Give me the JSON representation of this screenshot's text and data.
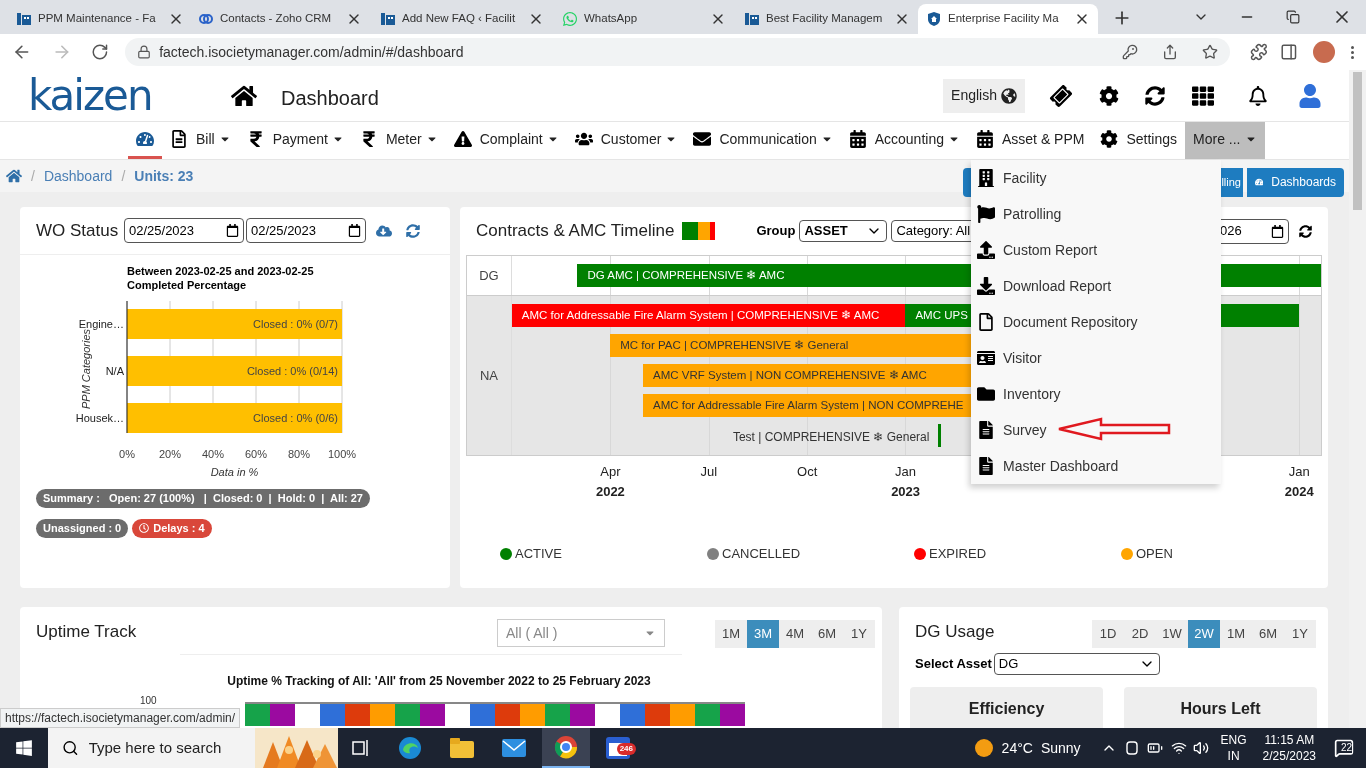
{
  "browser": {
    "tabs": [
      {
        "title": "PPM Maintenance - Fa",
        "selected": false
      },
      {
        "title": "Contacts - Zoho CRM",
        "selected": false
      },
      {
        "title": "Add New FAQ ‹ Facilit",
        "selected": false
      },
      {
        "title": "WhatsApp",
        "selected": false
      },
      {
        "title": "Best Facility Managem",
        "selected": false
      },
      {
        "title": "Enterprise Facility Ma",
        "selected": true
      }
    ],
    "url": "factech.isocietymanager.com/admin/#/dashboard",
    "status_url": "https://factech.isocietymanager.com/admin/"
  },
  "header": {
    "logo": "kaizen",
    "title": "Dashboard",
    "language": "English"
  },
  "nav": [
    {
      "selected": true,
      "dropdown": false
    },
    {
      "label": "Bill",
      "dropdown": true,
      "selected": false
    },
    {
      "label": "Payment",
      "dropdown": true,
      "selected": false
    },
    {
      "label": "Meter",
      "dropdown": true,
      "selected": false
    },
    {
      "label": "Complaint",
      "dropdown": true,
      "selected": false
    },
    {
      "label": "Customer",
      "dropdown": true,
      "selected": false
    },
    {
      "label": "Communication",
      "dropdown": true,
      "selected": false
    },
    {
      "label": "Accounting",
      "dropdown": true,
      "selected": false
    },
    {
      "label": "Asset & PPM",
      "dropdown": false,
      "selected": false
    },
    {
      "label": "Settings",
      "dropdown": false,
      "selected": false
    },
    {
      "label": "More ...",
      "dropdown": true,
      "selected": false,
      "open": true
    }
  ],
  "breadcrumb": {
    "separators": [
      "/",
      "/"
    ],
    "items": [
      "Dashboard"
    ],
    "units": "Units: 23",
    "buttons": [
      "lling",
      "Dashboards"
    ]
  },
  "more_menu": {
    "items": [
      {
        "label": "Facility",
        "annotated": false
      },
      {
        "label": "Patrolling",
        "annotated": false
      },
      {
        "label": "Custom Report",
        "annotated": false
      },
      {
        "label": "Download Report",
        "annotated": false
      },
      {
        "label": "Document Repository",
        "annotated": false
      },
      {
        "label": "Visitor",
        "annotated": false
      },
      {
        "label": "Inventory",
        "annotated": false
      },
      {
        "label": "Survey",
        "annotated": true
      },
      {
        "label": "Master Dashboard",
        "annotated": false
      }
    ]
  },
  "wo_status": {
    "title": "WO Status",
    "dates": [
      "02/25/2023",
      "02/25/2023"
    ],
    "chart_data": {
      "type": "bar",
      "orientation": "horizontal",
      "grid": true,
      "title": "Between 2023-02-25 and 2023-02-25\nCompleted Percentage",
      "xlabel": "Data in %",
      "ylabel": "PPM Categories",
      "categories": [
        "Engine…",
        "N/A",
        "Housek…"
      ],
      "series": [
        {
          "color": "#ffbf00",
          "values": [
            100,
            100,
            100
          ]
        }
      ],
      "xlim": [
        0,
        100
      ],
      "xticks": [
        {
          "value": 0,
          "label": "0%"
        },
        {
          "value": 20,
          "label": "20%"
        },
        {
          "value": 40,
          "label": "40%"
        },
        {
          "value": 60,
          "label": "60%"
        },
        {
          "value": 80,
          "label": "80%"
        },
        {
          "value": 100,
          "label": "100%"
        }
      ],
      "value_labels": [
        "Closed : 0% (0/7)",
        "Closed : 0% (0/14)",
        "Closed : 0% (0/6)"
      ]
    },
    "summary": "Summary :   Open: 27 (100%)   |  Closed: 0  |  Hold: 0  |  All: 27",
    "badges": [
      {
        "label": "Unassigned : 0",
        "kind": "neutral"
      },
      {
        "label": "Delays : 4",
        "kind": "alert"
      }
    ]
  },
  "contracts": {
    "title": "Contracts & AMC Timeline",
    "group_label": "Group",
    "group": "ASSET",
    "category": "Category: All",
    "date_fragment": "026",
    "groups": [
      {
        "label": "DG",
        "lanes": [
          [
            {
              "label": "DG AMC | COMPREHENSIVE ❄ AMC",
              "color": "#008000",
              "kind": "bar"
            }
          ]
        ]
      },
      {
        "label": "NA",
        "lanes": [
          [
            {
              "label": "AMC for Addressable Fire Alarm System | COMPREHENSIVE ❄ AMC",
              "color": "#ff0000",
              "kind": "bar"
            },
            {
              "label": "AMC UPS",
              "color": "#008000",
              "kind": "bar"
            }
          ],
          [
            {
              "label": "MC for PAC | COMPREHENSIVE ❄ General",
              "color": "#ffa500",
              "kind": "bar"
            }
          ],
          [
            {
              "label": "AMC VRF System | NON COMPREHENSIVE ❄ AMC",
              "color": "#ffa500",
              "kind": "bar"
            }
          ],
          [
            {
              "label": "AMC for Addressable Fire Alarm System | NON COMPREHE",
              "color": "#ffa500",
              "kind": "bar"
            }
          ],
          [
            {
              "label": "Test | COMPREHENSIVE ❄ General",
              "color": "#008000",
              "kind": "marker"
            }
          ]
        ]
      }
    ],
    "axis": [
      {
        "label": "Apr",
        "year": "2022"
      },
      {
        "label": "Jul"
      },
      {
        "label": "Oct"
      },
      {
        "label": "Jan",
        "year": "2023"
      },
      {
        "label": "Jan",
        "year": "2024"
      }
    ],
    "legend": [
      {
        "label": "ACTIVE",
        "color": "#008000"
      },
      {
        "label": "CANCELLED",
        "color": "#808080"
      },
      {
        "label": "EXPIRED",
        "color": "#ff0000"
      },
      {
        "label": "OPEN",
        "color": "#ffa500"
      }
    ]
  },
  "uptime": {
    "title": "Uptime Track",
    "filter": "All ( All )",
    "ranges": [
      {
        "label": "1M",
        "selected": false
      },
      {
        "label": "3M",
        "selected": true
      },
      {
        "label": "4M",
        "selected": false
      },
      {
        "label": "6M",
        "selected": false
      },
      {
        "label": "1Y",
        "selected": false
      }
    ],
    "chart_title": "Uptime % Tracking of All: 'All' from 25 November 2022 to 25 February 2023",
    "y_tick": "100"
  },
  "dg_usage": {
    "title": "DG Usage",
    "ranges": [
      {
        "label": "1D",
        "selected": false
      },
      {
        "label": "2D",
        "selected": false
      },
      {
        "label": "1W",
        "selected": false
      },
      {
        "label": "2W",
        "selected": true
      },
      {
        "label": "1M",
        "selected": false
      },
      {
        "label": "6M",
        "selected": false
      },
      {
        "label": "1Y",
        "selected": false
      }
    ],
    "asset_label": "Select Asset",
    "asset": "DG",
    "cards": [
      "Efficiency",
      "Hours Left"
    ]
  },
  "taskbar": {
    "search_placeholder": "Type here to search",
    "mail_badge": "246",
    "temperature": "24°C",
    "condition": "Sunny",
    "language": [
      "ENG",
      "IN"
    ],
    "time": "11:15 AM",
    "date": "2/25/2023",
    "notifications": "22"
  }
}
